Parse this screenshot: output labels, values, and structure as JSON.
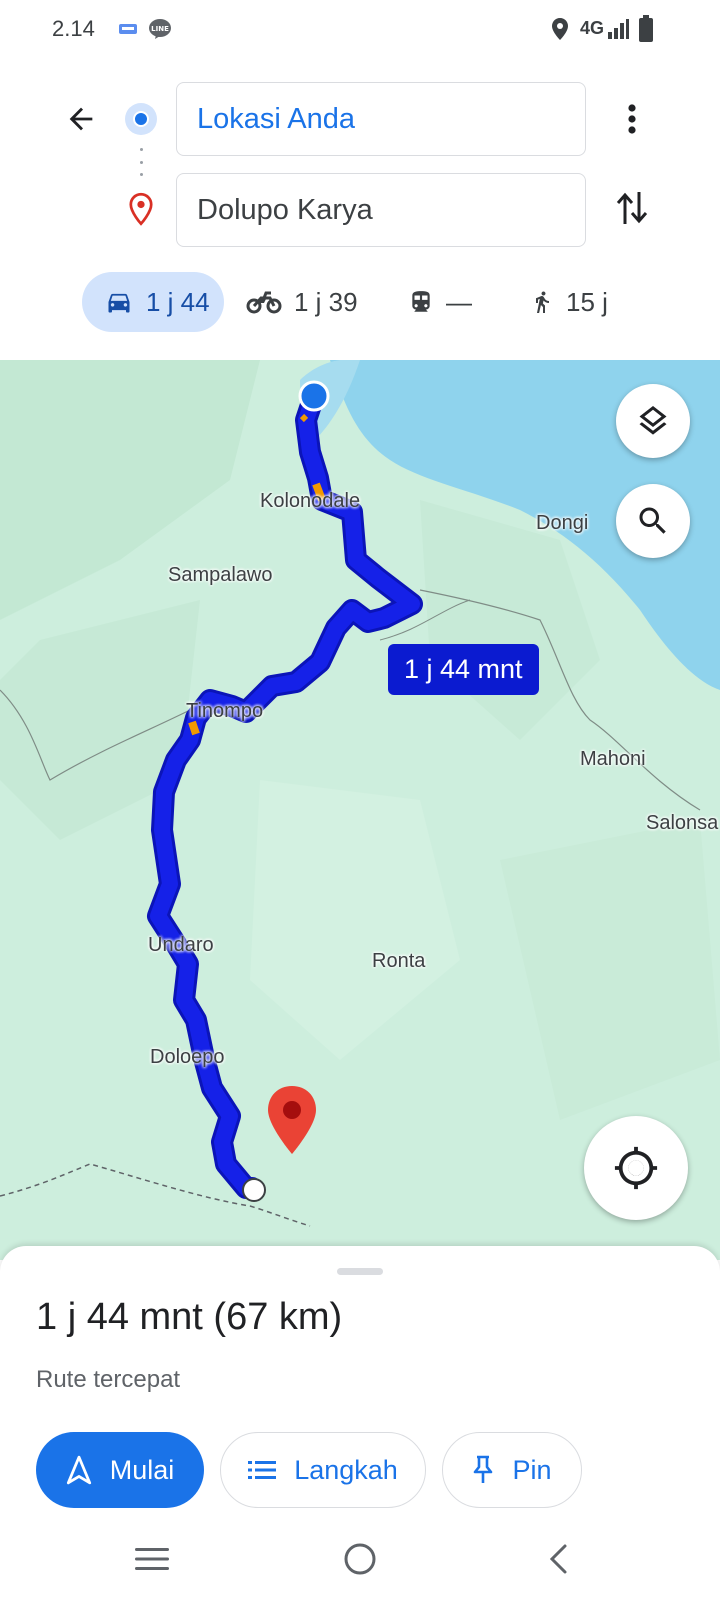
{
  "status_bar": {
    "time": "2.14",
    "network": "4G",
    "icons": [
      "notification-app-icon",
      "line-app-icon",
      "location-icon",
      "signal-icon",
      "battery-icon"
    ]
  },
  "directions": {
    "origin": "Lokasi Anda",
    "destination": "Dolupo Karya"
  },
  "modes": [
    {
      "name": "car",
      "icon": "car-icon",
      "time": "1 j 44",
      "selected": true
    },
    {
      "name": "motorcycle",
      "icon": "motorcycle-icon",
      "time": "1 j 39",
      "selected": false
    },
    {
      "name": "transit",
      "icon": "train-icon",
      "time": "—",
      "selected": false
    },
    {
      "name": "walk",
      "icon": "walking-icon",
      "time": "15 j",
      "selected": false
    }
  ],
  "map": {
    "route_label": "1 j 44 mnt",
    "places": [
      "Kolonodale",
      "Dongi",
      "Sampalawo",
      "Tinompo",
      "Mahoni",
      "Salonsa",
      "Undaro",
      "Ronta",
      "Doloepo"
    ],
    "colors": {
      "land": "#cdeedd",
      "water": "#8fd3ed",
      "route": "#1521e8",
      "route_outline": "#0b14b8",
      "pin": "#ea4335"
    }
  },
  "summary": {
    "duration_distance": "1 j 44 mnt (67 km)",
    "subtitle": "Rute tercepat"
  },
  "actions": {
    "start": "Mulai",
    "steps": "Langkah",
    "pin": "Pin"
  },
  "accent": "#1a73e8"
}
